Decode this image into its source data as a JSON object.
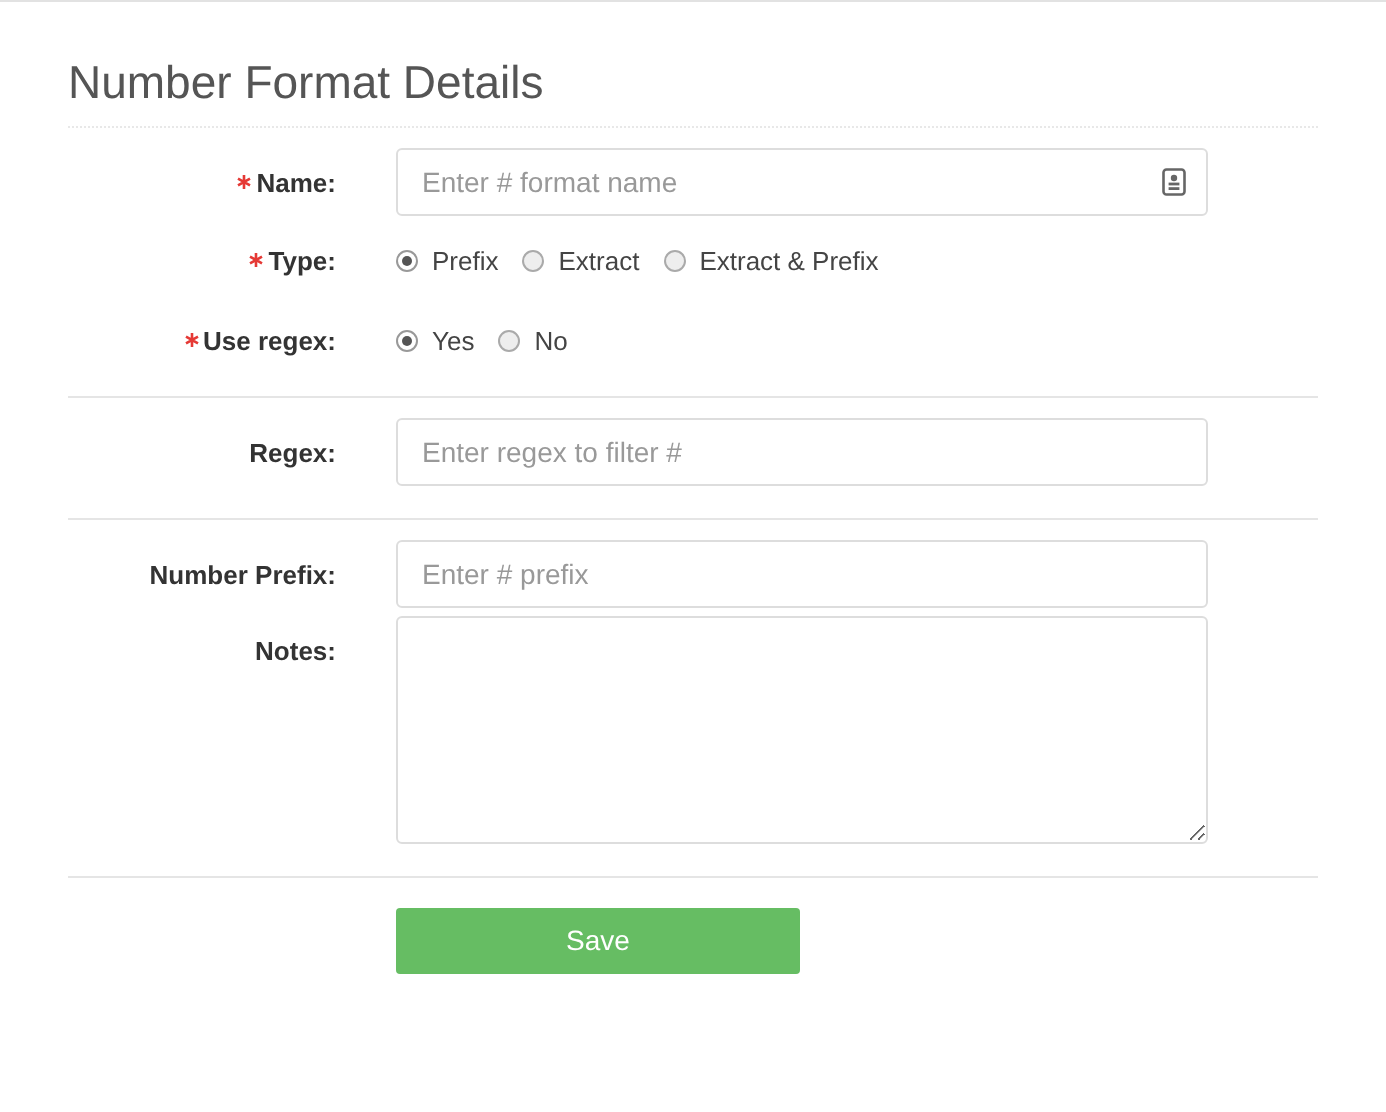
{
  "title": "Number Format Details",
  "sections": [
    {
      "fields": [
        {
          "kind": "text",
          "label": "Name:",
          "required": true,
          "placeholder": "Enter # format name",
          "icon": true
        },
        {
          "kind": "radio",
          "label": "Type:",
          "required": true,
          "options": [
            {
              "label": "Prefix",
              "selected": true
            },
            {
              "label": "Extract",
              "selected": false
            },
            {
              "label": "Extract & Prefix",
              "selected": false
            }
          ]
        },
        {
          "kind": "radio",
          "label": "Use regex:",
          "required": true,
          "options": [
            {
              "label": "Yes",
              "selected": true
            },
            {
              "label": "No",
              "selected": false
            }
          ]
        }
      ]
    },
    {
      "fields": [
        {
          "kind": "text",
          "label": "Regex:",
          "required": false,
          "placeholder": "Enter regex to filter #",
          "icon": false
        }
      ]
    },
    {
      "fields": [
        {
          "kind": "text",
          "label": "Number Prefix:",
          "required": false,
          "placeholder": "Enter # prefix",
          "icon": false
        },
        {
          "kind": "textarea",
          "label": "Notes:",
          "required": false
        }
      ]
    }
  ],
  "button": "Save"
}
